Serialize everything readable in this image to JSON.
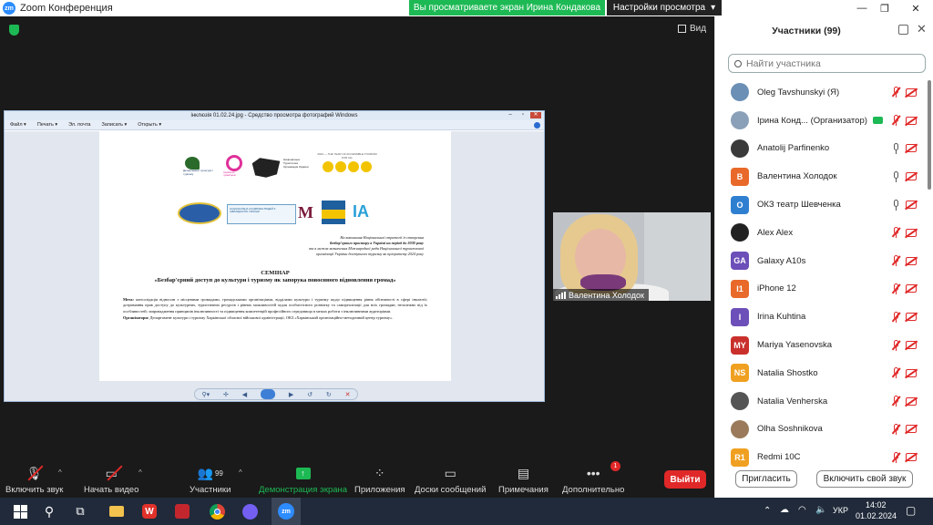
{
  "titlebar": {
    "app_title": "Zoom Конференция",
    "share_banner": "Вы просматриваете экран Ирина Кондакова",
    "view_settings": "Настройки просмотра",
    "logo_text": "zm"
  },
  "meeting": {
    "view_label": "Вид"
  },
  "viewer": {
    "title": "інклюзія 01.02.24.jpg - Средство просмотра фотографий Windows",
    "menu": [
      "Файл ▾",
      "Печать ▾",
      "Эл. почта",
      "Записать ▾",
      "Открыть ▾"
    ],
    "doc": {
      "logo_texts": {
        "dept": "Департамент культури і туризму",
        "school": "Харківська гуманітарно",
        "ntsou": "Національна Туристична Організація України",
        "year": "2024 — THE YEAR OF ACCESSIBLE TOURISM FOR ALL",
        "assoc": "НАЦІОНАЛЬНА АСАМБЛЕЯ ЛЮДЕЙ З ІНВАЛІДНІСТЮ УКРАЇНИ"
      },
      "right_note_1": "На виконання Національної стратегії із створення",
      "right_note_2": "безбар'єрного простору в Україні на період до 2030 року",
      "right_note_3": "та в межах визначення Міжнародної ради Національної туристичної",
      "right_note_4": "організації України доступного туризму як пріоритету 2024 року",
      "heading_1": "СЕМІНАР",
      "heading_2": "«Безбар'єрний доступ до культури і туризму як запорука повоєнного відновлення громад»",
      "goal_label": "Мета:",
      "goal_text": "консолідація відносин з місцевими громадами, громадськими організаціями, відділами культури і туризму щодо підвищення рівня обізнаності в сфері інклюзії; дотримання прав доступу до культурних, туристичних ресурсів і рівних можливостей задля особистісного розвитку та самореалізації для всіх громадян, незалежно від їх особливостей; запровадження принципів інклюзивності та підвищення компетенцій професійного середовища в межах роботи з інклюзивними аудиторіями.",
      "org_label": "Організатори:",
      "org_text": "Департамент культури і туризму Харківської обласної військової адміністрації, ОКЗ «Харківський організаційно-методичний центр туризму»."
    }
  },
  "video_tile": {
    "name": "Валентина Холодок"
  },
  "toolbar": {
    "unmute": "Включить звук",
    "start_video": "Начать видео",
    "participants": "Участники",
    "participants_count": "99",
    "share_screen": "Демонстрация экрана",
    "apps": "Приложения",
    "whiteboards": "Доски сообщений",
    "notes": "Примечания",
    "more": "Дополнительно",
    "more_badge": "1",
    "leave": "Выйти"
  },
  "panel": {
    "title": "Участники (99)",
    "search_placeholder": "Найти участника",
    "participants": [
      {
        "name": "Oleg Tavshunskyi (Я)",
        "avatar": "",
        "color": "#6b8fb5",
        "mic": "off",
        "cam": "off"
      },
      {
        "name": "Ірина Конд... (Организатор)",
        "avatar": "",
        "color": "#8aa0b8",
        "mic": "off",
        "cam": "off",
        "host": true
      },
      {
        "name": "Anatolij Parfinenko",
        "avatar": "",
        "color": "#3a3a3a",
        "mic": "on",
        "cam": "off"
      },
      {
        "name": "Валентина Холодок",
        "avatar": "В",
        "color": "#e8692a",
        "mic": "on",
        "cam": "off"
      },
      {
        "name": "ОКЗ театр Шевченка",
        "avatar": "О",
        "color": "#2f7fd1",
        "mic": "on",
        "cam": "off"
      },
      {
        "name": "Alex Alex",
        "avatar": "",
        "color": "#222222",
        "mic": "off",
        "cam": "off"
      },
      {
        "name": "Galaxy A10s",
        "avatar": "GA",
        "color": "#6c4fb8",
        "mic": "off",
        "cam": "off"
      },
      {
        "name": "iPhone 12",
        "avatar": "I1",
        "color": "#e8692a",
        "mic": "off",
        "cam": "off"
      },
      {
        "name": "Irina Kuhtina",
        "avatar": "I",
        "color": "#6c4fb8",
        "mic": "off",
        "cam": "off"
      },
      {
        "name": "Mariya Yasenovska",
        "avatar": "MY",
        "color": "#c9302c",
        "mic": "off",
        "cam": "off"
      },
      {
        "name": "Natalia Shostko",
        "avatar": "NS",
        "color": "#f0a020",
        "mic": "off",
        "cam": "off"
      },
      {
        "name": "Natalia Venherska",
        "avatar": "",
        "color": "#555555",
        "mic": "off",
        "cam": "off"
      },
      {
        "name": "Olha Soshnikova",
        "avatar": "",
        "color": "#9a7a5a",
        "mic": "off",
        "cam": "off"
      },
      {
        "name": "Redmi 10C",
        "avatar": "R1",
        "color": "#f0a020",
        "mic": "off",
        "cam": "off"
      }
    ],
    "invite": "Пригласить",
    "unmute_me": "Включить свой звук"
  },
  "taskbar": {
    "lang": "УКР",
    "time": "14:02",
    "date": "01.02.2024"
  }
}
